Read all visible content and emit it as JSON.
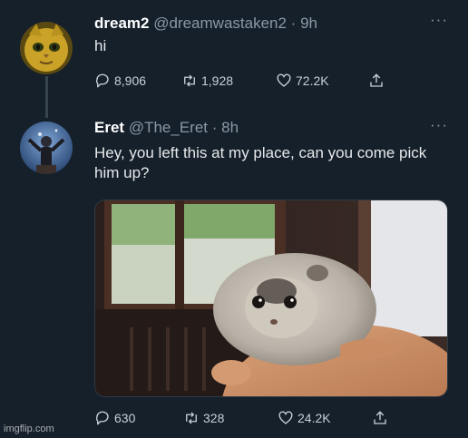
{
  "tweets": [
    {
      "name": "dream2",
      "handle": "@dreamwastaken2",
      "dot": "·",
      "time": "9h",
      "text": "hi",
      "more": "···",
      "replies": "8,906",
      "retweets": "1,928",
      "likes": "72.2K"
    },
    {
      "name": "Eret",
      "handle": "@The_Eret",
      "dot": "·",
      "time": "8h",
      "text": "Hey, you left this at my place, can you come pick him up?",
      "more": "···",
      "replies": "630",
      "retweets": "328",
      "likes": "24.2K"
    }
  ],
  "icons": {
    "reply": "reply-icon",
    "retweet": "retweet-icon",
    "like": "heart-icon",
    "share": "share-icon"
  },
  "colors": {
    "background": "#15202b",
    "text": "#e7e9ea",
    "muted": "#8b98a5"
  },
  "watermark": "imgflip.com"
}
